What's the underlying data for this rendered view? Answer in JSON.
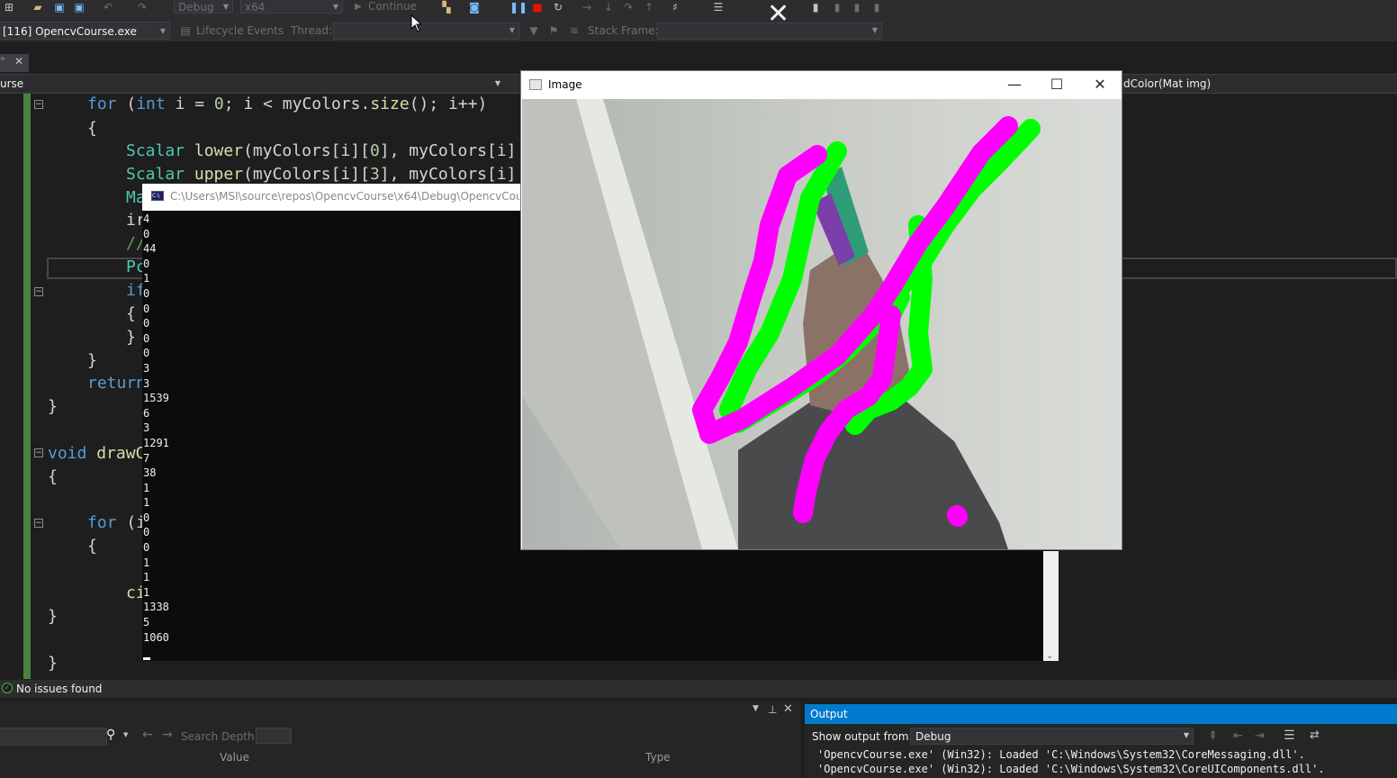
{
  "toolbar": {
    "config": "Debug",
    "platform": "x64",
    "continue_label": "Continue",
    "process": "[116] OpencvCourse.exe",
    "lifecycle_label": "Lifecycle Events",
    "thread_label": "Thread:",
    "stackframe_label": "Stack Frame:"
  },
  "editor": {
    "tab_partial": "urse",
    "member_partial": "dColor(Mat img)",
    "lines": [
      "for (int i = 0; i < myColors.size(); i++)",
      "{",
      "Scalar lower(myColors[i][0], myColors[i]",
      "Scalar upper(myColors[i][3], myColors[i]",
      "Ma",
      "ir",
      "//",
      "Pc",
      "if",
      "{",
      "}",
      "}",
      "retur",
      "}",
      "void drawC",
      "{",
      "for (i",
      "{",
      "ci",
      "}",
      "}"
    ]
  },
  "console": {
    "title": "C:\\Users\\MSI\\source\\repos\\OpencvCourse\\x64\\Debug\\OpencvCourse",
    "lines": [
      "4",
      "0",
      "44",
      "0",
      "1",
      "0",
      "0",
      "0",
      "0",
      "0",
      "3",
      "3",
      "1539",
      "6",
      "3",
      "1291",
      "7",
      "38",
      "1",
      "1",
      "0",
      "0",
      "0",
      "1",
      "1",
      "1",
      "1338",
      "5",
      "1060"
    ]
  },
  "image_window": {
    "title": "Image",
    "minimize": "—",
    "maximize": "☐",
    "close": "✕",
    "colors": {
      "green": "#00ff00",
      "magenta": "#ff00ff"
    }
  },
  "status": {
    "issues": "No issues found"
  },
  "watch_panel": {
    "search_depth_label": "Search Depth:",
    "col_value": "Value",
    "col_type": "Type"
  },
  "output_panel": {
    "title": "Output",
    "show_from_label": "Show output from:",
    "source": "Debug",
    "lines": [
      "'OpencvCourse.exe' (Win32): Loaded 'C:\\Windows\\System32\\CoreMessaging.dll'.",
      "'OpencvCourse.exe' (Win32): Loaded 'C:\\Windows\\System32\\CoreUIComponents.dll'."
    ]
  },
  "overlay_close": "✕"
}
